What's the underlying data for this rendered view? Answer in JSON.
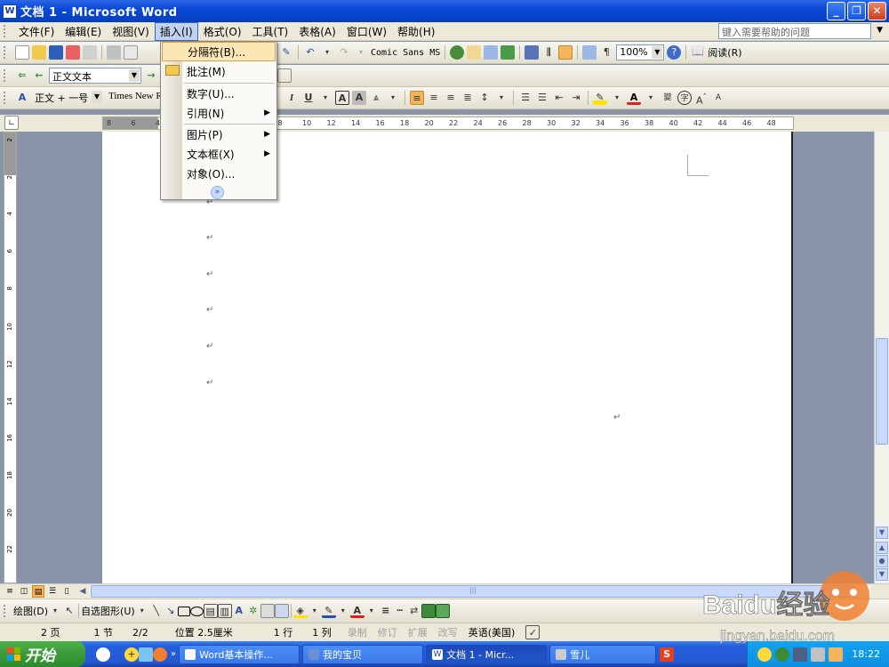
{
  "window": {
    "title": "文档 1 - Microsoft Word",
    "app_icon": "W",
    "controls": [
      "minimize",
      "maximize",
      "close"
    ]
  },
  "menubar": {
    "items": [
      {
        "label": "文件(F)"
      },
      {
        "label": "编辑(E)"
      },
      {
        "label": "视图(V)"
      },
      {
        "label": "插入(I)",
        "active": true
      },
      {
        "label": "格式(O)"
      },
      {
        "label": "工具(T)"
      },
      {
        "label": "表格(A)"
      },
      {
        "label": "窗口(W)"
      },
      {
        "label": "帮助(H)"
      }
    ],
    "help_placeholder": "键入需要帮助的问题"
  },
  "standard_toolbar": {
    "font_sample": "Comic Sans MS",
    "zoom": "100%",
    "read_label": "阅读(R)"
  },
  "outline_toolbar": {
    "style_value": "正文文本"
  },
  "format_toolbar": {
    "style_value": "正文 + 一号",
    "font_value": "Times New R"
  },
  "insert_menu": {
    "items": [
      {
        "label": "分隔符(B)...",
        "highlight": true
      },
      {
        "label": "批注(M)",
        "icon": "folder-icon"
      },
      {
        "label": "数字(U)..."
      },
      {
        "label": "引用(N)",
        "submenu": true
      },
      {
        "label": "图片(P)",
        "submenu": true
      },
      {
        "label": "文本框(X)",
        "submenu": true
      },
      {
        "label": "对象(O)..."
      }
    ],
    "expand_icon": "chevron-double-down-icon"
  },
  "ruler": {
    "ticks": [
      "8",
      "6",
      "4",
      "2",
      "2",
      "4",
      "6",
      "8",
      "10",
      "12",
      "14",
      "16",
      "18",
      "20",
      "22",
      "24",
      "26",
      "28",
      "30",
      "32",
      "34",
      "36",
      "38",
      "40",
      "42",
      "44",
      "46",
      "48"
    ]
  },
  "vruler": {
    "ticks": [
      "2",
      "2",
      "4",
      "6",
      "8",
      "10",
      "12",
      "14",
      "16",
      "18",
      "20",
      "22"
    ]
  },
  "document": {
    "paragraph_mark": "↵"
  },
  "drawing_toolbar": {
    "draw_label": "绘图(D)",
    "autoshape_label": "自选图形(U)"
  },
  "statusbar": {
    "page": "2 页",
    "section": "1 节",
    "page_of": "2/2",
    "position": "位置 2.5厘米",
    "line": "1 行",
    "column": "1 列",
    "rec": "录制",
    "trk": "修订",
    "ext": "扩展",
    "ovr": "改写",
    "language": "英语(美国)"
  },
  "taskbar": {
    "start_label": "开始",
    "tasks": [
      {
        "label": "Word基本操作..."
      },
      {
        "label": "我的宝贝"
      },
      {
        "label": "文档 1 - Micr...",
        "active": true
      },
      {
        "label": "雪儿"
      }
    ],
    "clock": "18:22"
  },
  "watermark": {
    "brand": "Baidu经验",
    "url": "jingyan.baidu.com"
  },
  "colors": {
    "titlebar": "#0a48d6",
    "menu_bg": "#ece9d8",
    "highlight": "#fbe7b4",
    "taskbar": "#245edb",
    "start": "#3c9a3a"
  }
}
